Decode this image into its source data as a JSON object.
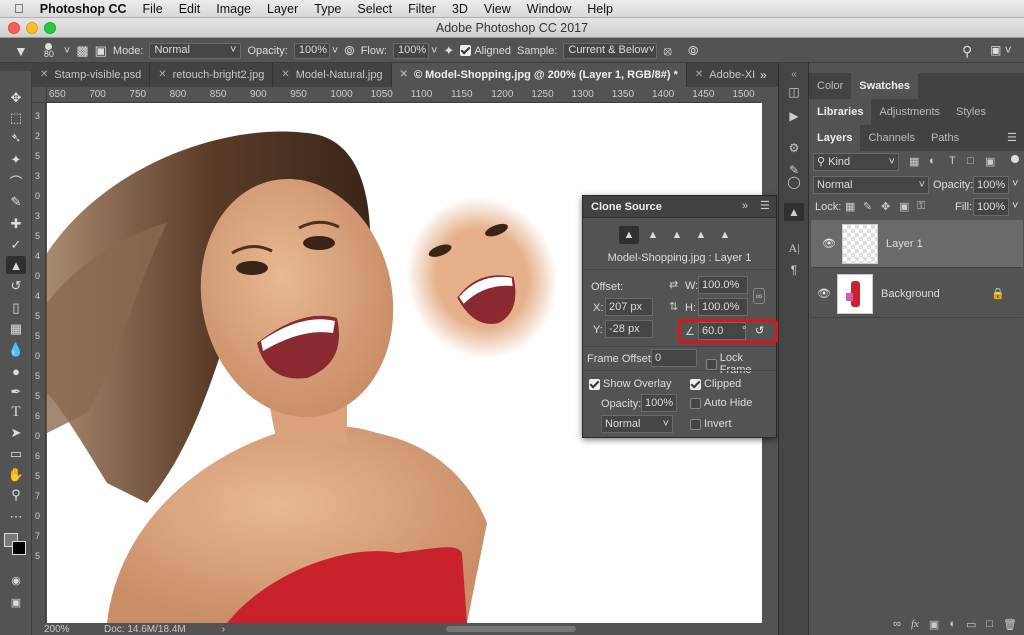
{
  "menu": {
    "app": "Photoshop CC",
    "items": [
      "File",
      "Edit",
      "Image",
      "Layer",
      "Type",
      "Select",
      "Filter",
      "3D",
      "View",
      "Window",
      "Help"
    ]
  },
  "window_title": "Adobe Photoshop CC 2017",
  "options": {
    "brush_size": "80",
    "mode_label": "Mode:",
    "mode_value": "Normal",
    "opacity_label": "Opacity:",
    "opacity_value": "100%",
    "flow_label": "Flow:",
    "flow_value": "100%",
    "aligned_label": "Aligned",
    "sample_label": "Sample:",
    "sample_value": "Current & Below"
  },
  "tabs": [
    {
      "label": "Stamp-visible.psd"
    },
    {
      "label": "retouch-bright2.jpg"
    },
    {
      "label": "Model-Natural.jpg"
    },
    {
      "label": "© Model-Shopping.jpg @ 200% (Layer 1, RGB/8#) *"
    },
    {
      "label": "Adobe-XI"
    }
  ],
  "ruler_ticks": [
    "650",
    "700",
    "750",
    "800",
    "850",
    "900",
    "950",
    "1000",
    "1050",
    "1100",
    "1150",
    "1200",
    "1250",
    "1300",
    "1350",
    "1400",
    "1450",
    "1500"
  ],
  "vruler_ticks": [
    "3",
    "2",
    "5",
    "3",
    "0",
    "3",
    "5",
    "4",
    "0",
    "4",
    "5",
    "5",
    "0",
    "5",
    "5",
    "6",
    "0",
    "6",
    "5",
    "7",
    "0",
    "7",
    "5"
  ],
  "status": {
    "zoom": "200%",
    "doc": "Doc: 14.6M/18.4M"
  },
  "clone_source": {
    "title": "Clone Source",
    "source_name": "Model-Shopping.jpg : Layer 1",
    "offset_label": "Offset:",
    "x_label": "X:",
    "x_value": "207 px",
    "y_label": "Y:",
    "y_value": "-28 px",
    "w_label": "W:",
    "w_value": "100.0%",
    "h_label": "H:",
    "h_value": "100.0%",
    "angle_value": "60.0",
    "angle_unit": "°",
    "frame_offset_label": "Frame Offset:",
    "frame_offset_value": "0",
    "lock_frame_label": "Lock Frame",
    "show_overlay_label": "Show Overlay",
    "clipped_label": "Clipped",
    "opacity_label": "Opacity:",
    "opacity_value": "100%",
    "auto_hide_label": "Auto Hide",
    "blend_value": "Normal",
    "invert_label": "Invert",
    "highlight_color": "#e0121b"
  },
  "right_panel": {
    "tabs_top": [
      "Color",
      "Swatches"
    ],
    "tabs_mid": [
      "Libraries",
      "Adjustments",
      "Styles"
    ],
    "tabs_layers": [
      "Layers",
      "Channels",
      "Paths"
    ],
    "kind_label": "Kind",
    "blend_value": "Normal",
    "opacity_label": "Opacity:",
    "opacity_value": "100%",
    "lock_label": "Lock:",
    "fill_label": "Fill:",
    "fill_value": "100%",
    "layers": [
      {
        "name": "Layer 1"
      },
      {
        "name": "Background"
      }
    ]
  }
}
